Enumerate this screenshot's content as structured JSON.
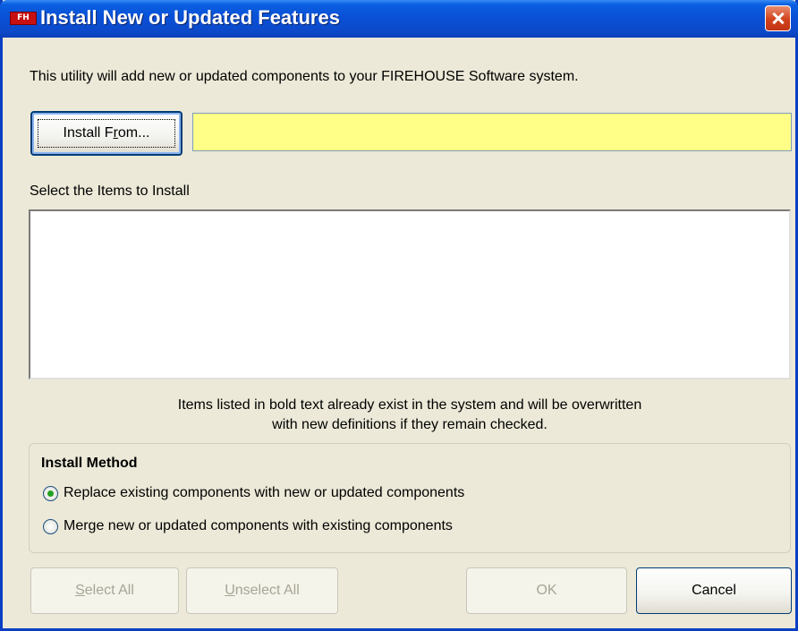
{
  "window": {
    "title": "Install New or Updated Features",
    "icon_text": "FH"
  },
  "intro_text": "This utility will add new or updated components to your FIREHOUSE Software system.",
  "install_from": {
    "label_pre": "Install F",
    "label_accel": "r",
    "label_post": "om...",
    "path_value": "",
    "path_color": "#ffff88"
  },
  "items": {
    "label": "Select the Items to Install",
    "list": []
  },
  "note": {
    "line1": "Items listed in bold text already exist in the system and will be overwritten",
    "line2": "with new definitions if they remain checked."
  },
  "install_method": {
    "title": "Install Method",
    "options": [
      {
        "label": "Replace existing components with new or updated components",
        "selected": true
      },
      {
        "label": "Merge new or updated components with existing components",
        "selected": false
      }
    ]
  },
  "buttons": {
    "select_all": {
      "accel": "S",
      "rest": "elect All",
      "enabled": false
    },
    "unselect_all": {
      "accel": "U",
      "rest": "nselect All",
      "enabled": false
    },
    "ok": {
      "label": "OK",
      "enabled": false
    },
    "cancel": {
      "label": "Cancel",
      "enabled": true
    }
  },
  "icons": {
    "close": "close-icon",
    "app": "firehouse-app-icon"
  }
}
